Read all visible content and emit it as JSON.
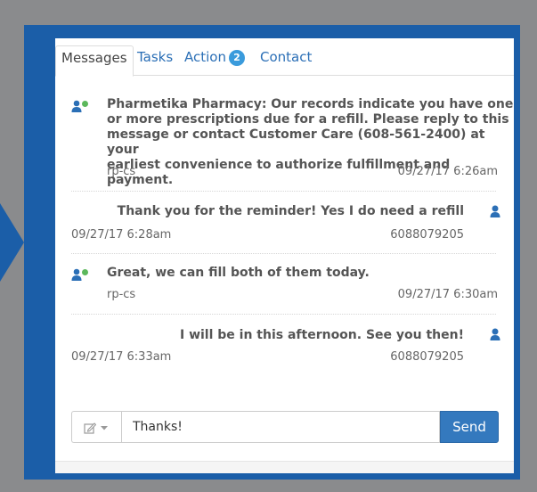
{
  "tabs": {
    "messages": "Messages",
    "tasks": "Tasks",
    "action": "Action",
    "action_badge": "2",
    "contact": "Contact"
  },
  "messages": [
    {
      "direction": "incoming",
      "lines": [
        "Pharmetika Pharmacy: Our records indicate you have one",
        "or more prescriptions due for a refill. Please reply to this",
        "message or contact Customer Care (608-561-2400) at your",
        "earliest convenience to authorize fulfillment and payment."
      ],
      "sender": "rp-cs",
      "time": "09/27/17 6:26am"
    },
    {
      "direction": "outgoing",
      "lines": [
        "Thank you for the reminder! Yes I do need a refill"
      ],
      "sender": "6088079205",
      "time": "09/27/17 6:28am"
    },
    {
      "direction": "incoming",
      "lines": [
        "Great, we can fill both of them today."
      ],
      "sender": "rp-cs",
      "time": "09/27/17 6:30am"
    },
    {
      "direction": "outgoing",
      "lines": [
        "I will be in this afternoon. See you then!"
      ],
      "sender": "6088079205",
      "time": "09/27/17 6:33am"
    }
  ],
  "compose": {
    "value": "Thanks!",
    "send_label": "Send",
    "template_icon": "pencil-square-icon",
    "dropdown_icon": "caret-down-icon"
  },
  "colors": {
    "frame": "#1b5ea8",
    "background": "#8a8b8d",
    "link": "#2b6fb6",
    "badge": "#3a9bdc",
    "agent_icon_green": "#5cb85c",
    "user_icon": "#2b6fb6",
    "send_button": "#3479be"
  }
}
